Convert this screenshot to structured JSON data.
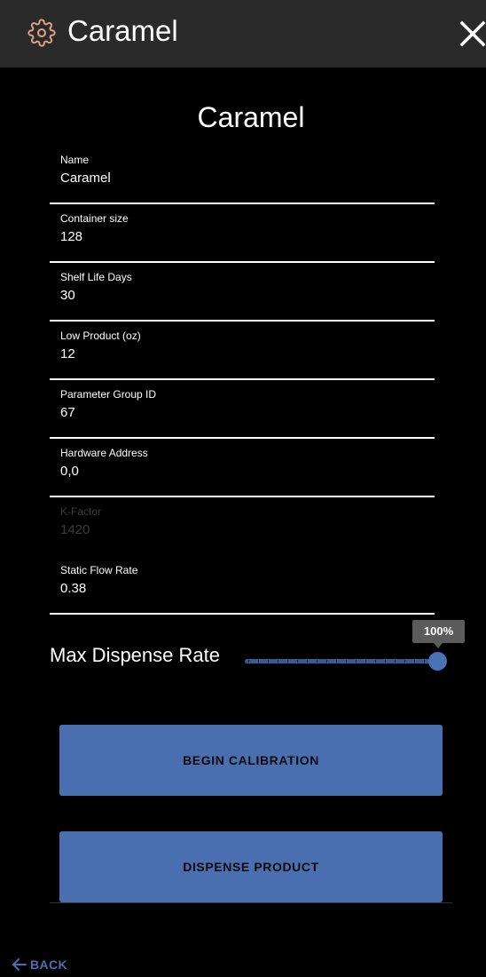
{
  "header": {
    "title": "Caramel",
    "icon": "gear-icon",
    "close_icon": "close-icon"
  },
  "form": {
    "title": "Caramel",
    "fields": [
      {
        "label": "Name",
        "value": "Caramel",
        "disabled": false
      },
      {
        "label": "Container size",
        "value": "128",
        "disabled": false
      },
      {
        "label": "Shelf Life Days",
        "value": "30",
        "disabled": false
      },
      {
        "label": "Low Product (oz)",
        "value": "12",
        "disabled": false
      },
      {
        "label": "Parameter Group ID",
        "value": "67",
        "disabled": false
      },
      {
        "label": "Hardware Address",
        "value": "0,0",
        "disabled": false
      },
      {
        "label": "K-Factor",
        "value": "1420",
        "disabled": true
      },
      {
        "label": "Static Flow Rate",
        "value": "0.38",
        "disabled": false
      }
    ]
  },
  "max_dispense_rate": {
    "label": "Max Dispense Rate",
    "value_percent": 100,
    "display": "100%"
  },
  "buttons": {
    "begin_calibration": "BEGIN CALIBRATION",
    "dispense_product": "DISPENSE PRODUCT"
  },
  "footer": {
    "back_label": "BACK",
    "back_icon": "arrow-left-icon"
  },
  "colors": {
    "accent": "#4a6fb0",
    "topbar": "#2a2a2a",
    "background": "#000000",
    "gear_icon": "#e0a088",
    "disabled_text": "#3c3c3c"
  }
}
